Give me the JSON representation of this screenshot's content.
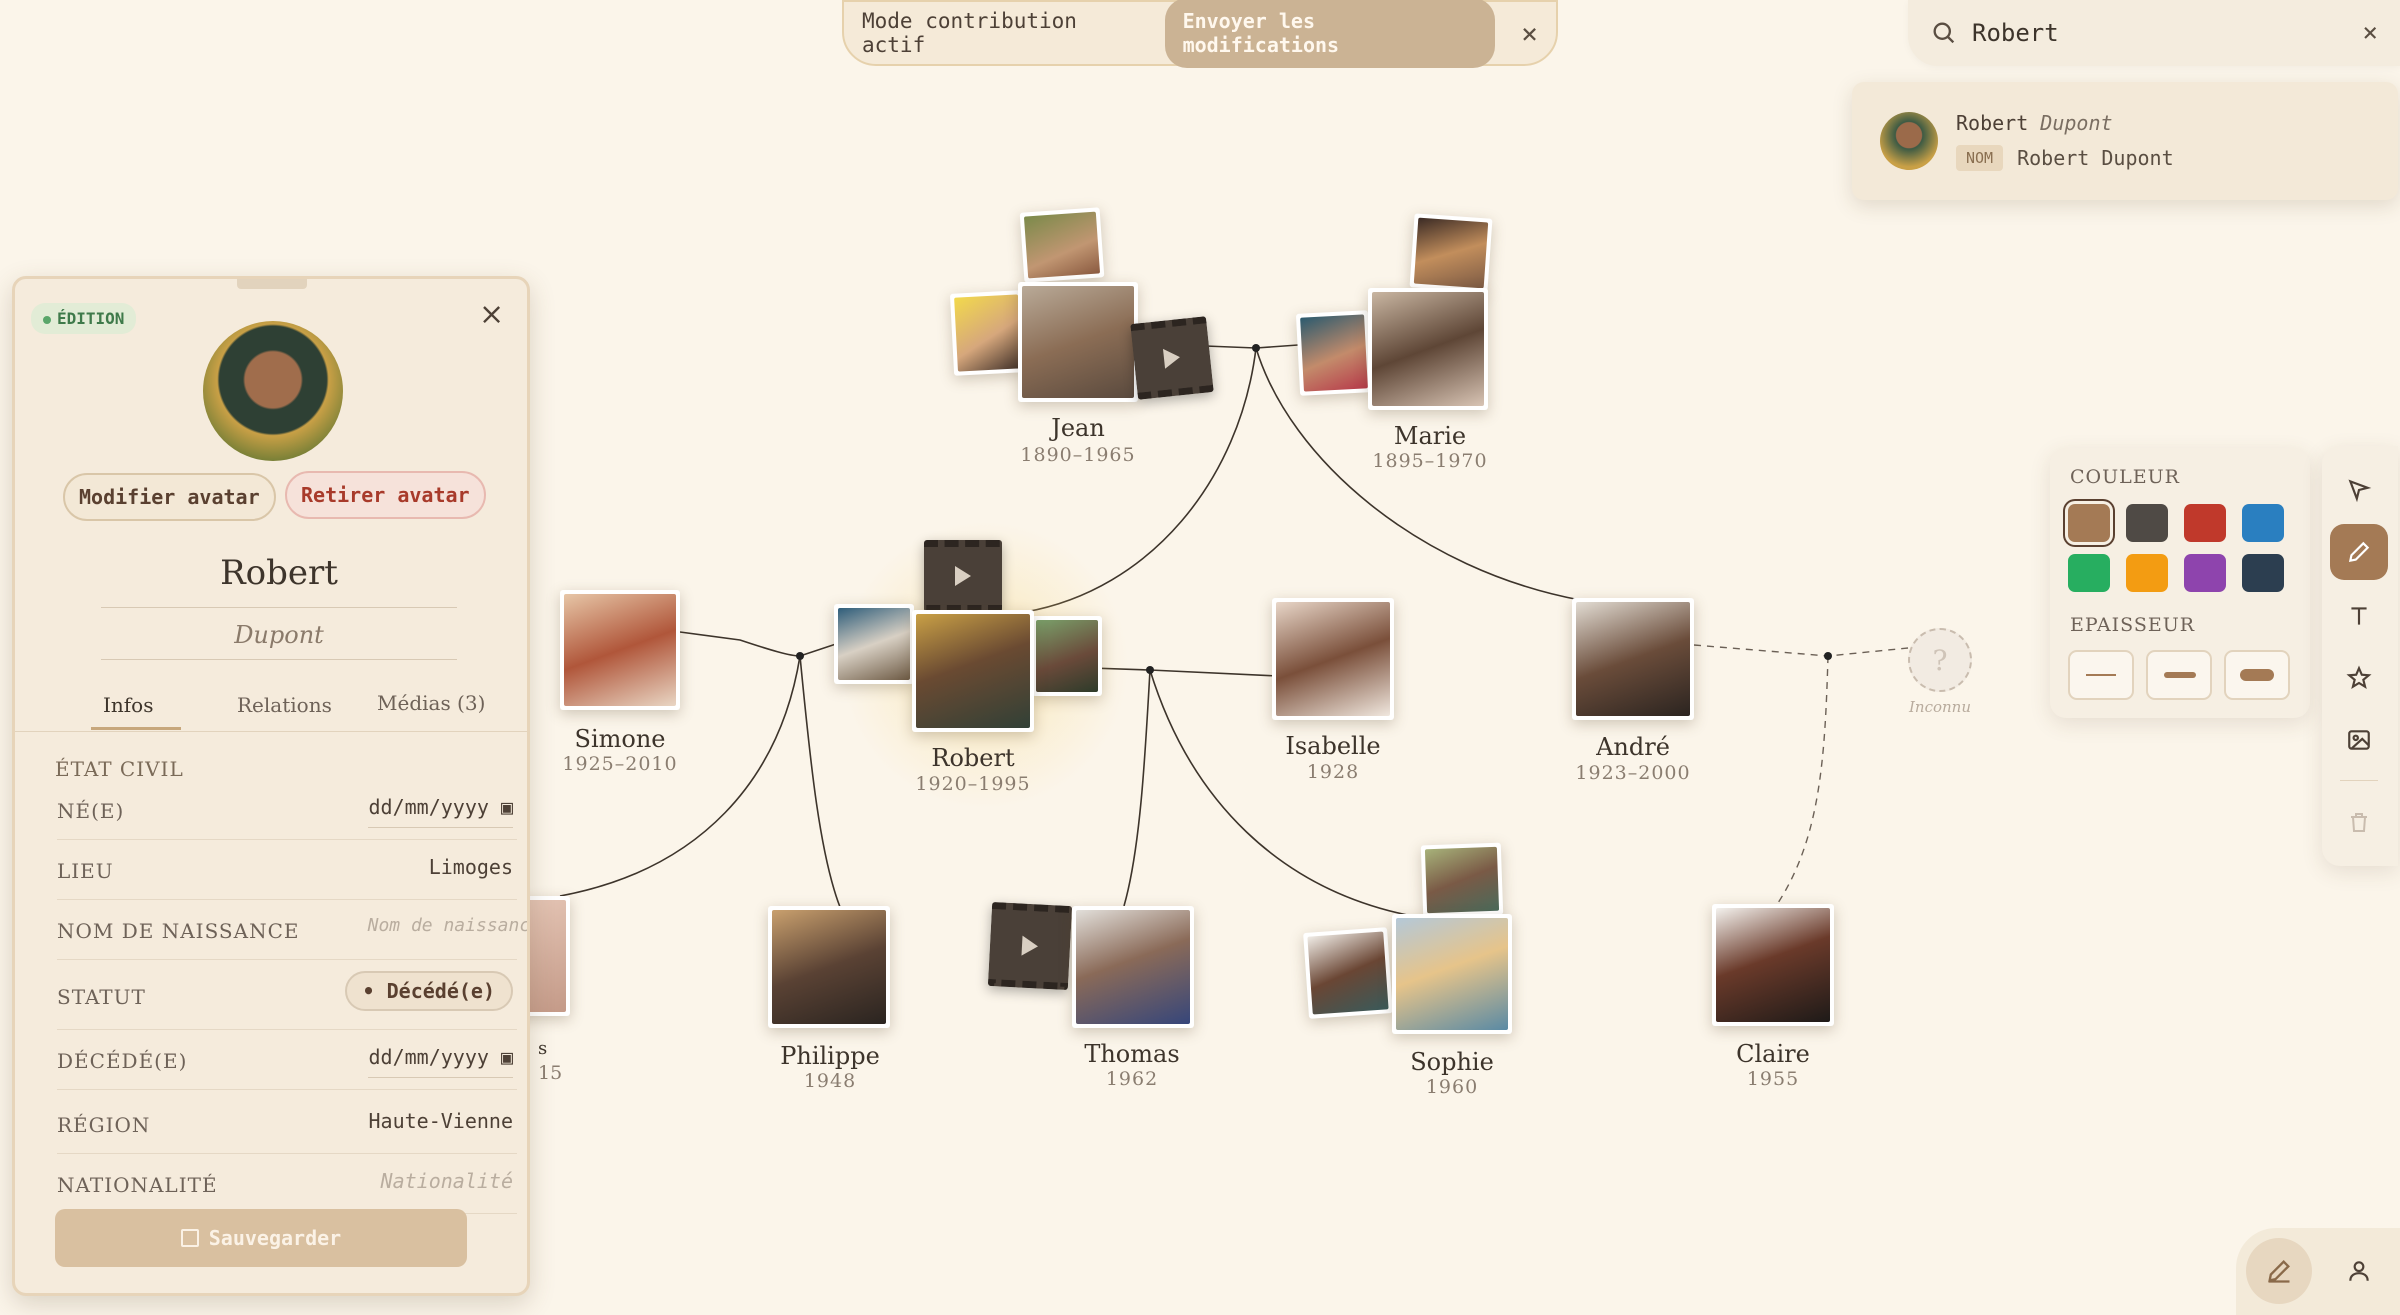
{
  "contribution": {
    "label": "Mode contribution actif",
    "send_label": "Envoyer les modifications",
    "close": "×"
  },
  "search": {
    "query": "Robert",
    "clear": "×"
  },
  "search_result": {
    "first": "Robert",
    "last": "Dupont",
    "badge": "NOM",
    "full": "Robert Dupont"
  },
  "panel": {
    "badge": "ÉDITION",
    "close": "×",
    "change_avatar": "Modifier avatar",
    "remove_avatar": "Retirer avatar",
    "first_name": "Robert",
    "last_name": "Dupont",
    "tabs": [
      "Infos",
      "Relations",
      "Médias (3)"
    ],
    "section": "ÉTAT CIVIL",
    "fields": [
      {
        "label": "NÉ(E)",
        "value": "dd/mm/yyyy"
      },
      {
        "label": "LIEU",
        "value": "Limoges"
      },
      {
        "label": "NOM DE NAISSANCE",
        "placeholder": "Nom de naissance"
      },
      {
        "label": "STATUT",
        "value": "Décédé(e)"
      },
      {
        "label": "DÉCÉDÉ(E)",
        "value": "dd/mm/yyyy"
      },
      {
        "label": "RÉGION",
        "value": "Haute-Vienne"
      },
      {
        "label": "NATIONALITÉ",
        "placeholder": "Nationalité"
      }
    ],
    "save": "Sauvegarder"
  },
  "tree": {
    "people": [
      {
        "name": "Jean",
        "dates": "1890–1965"
      },
      {
        "name": "Marie",
        "dates": "1895–1970"
      },
      {
        "name": "Simone",
        "dates": "1925–2010"
      },
      {
        "name": "Robert",
        "dates": "1920–1995"
      },
      {
        "name": "Isabelle",
        "dates": "1928"
      },
      {
        "name": "André",
        "dates": "1923–2000"
      },
      {
        "name": "Philippe",
        "dates": "1948"
      },
      {
        "name": "Thomas",
        "dates": "1962"
      },
      {
        "name": "Sophie",
        "dates": "1960"
      },
      {
        "name": "Claire",
        "dates": "1955"
      }
    ],
    "unknown": {
      "symbol": "?",
      "label": "Inconnu"
    },
    "partial": {
      "name": "s",
      "dates": "15"
    }
  },
  "style_panel": {
    "color_title": "COULEUR",
    "thickness_title": "EPAISSEUR",
    "colors": [
      "#a47a55",
      "#4f4a45",
      "#c0392b",
      "#2a7fc0",
      "#27ae60",
      "#f39c12",
      "#8e44ad",
      "#2c3e50"
    ]
  }
}
